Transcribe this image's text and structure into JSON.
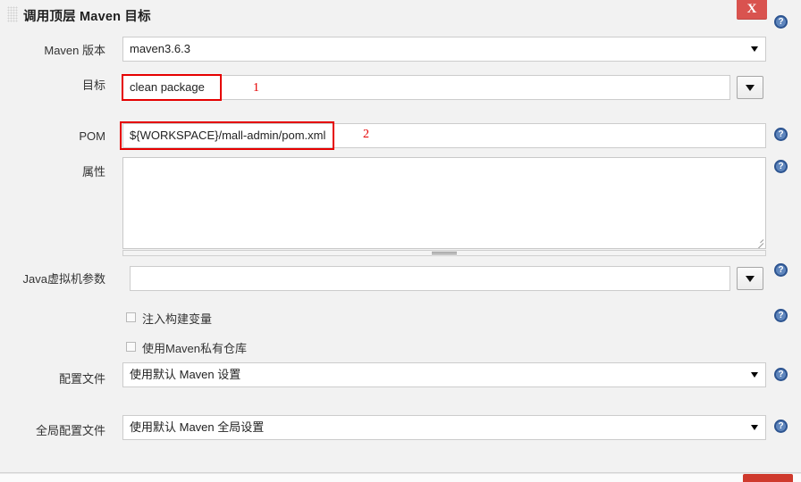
{
  "panel": {
    "title": "调用顶层 Maven 目标",
    "close_label": "X",
    "grip_name": "drag-handle"
  },
  "help": {
    "glyph": "?"
  },
  "rows": {
    "maven_version": {
      "label": "Maven 版本",
      "value": "maven3.6.3"
    },
    "goals": {
      "label": "目标",
      "value": "clean package",
      "annotation": "1"
    },
    "pom": {
      "label": "POM",
      "value": "${WORKSPACE}/mall-admin/pom.xml",
      "annotation": "2"
    },
    "properties": {
      "label": "属性",
      "value": ""
    },
    "jvm_options": {
      "label": "Java虚拟机参数",
      "value": ""
    },
    "inject_build_variables": {
      "label": "注入构建变量",
      "checked": false
    },
    "use_private_repository": {
      "label": "使用Maven私有仓库",
      "checked": false
    },
    "settings_file": {
      "label": "配置文件",
      "value": "使用默认 Maven 设置"
    },
    "global_settings_file": {
      "label": "全局配置文件",
      "value": "使用默认 Maven 全局设置"
    }
  },
  "colors": {
    "annotation_red": "#e50000",
    "close_red": "#d9534f",
    "help_blue": "#5f86bd",
    "footer_red": "#cf3a2d",
    "background": "#f2f2f2"
  }
}
